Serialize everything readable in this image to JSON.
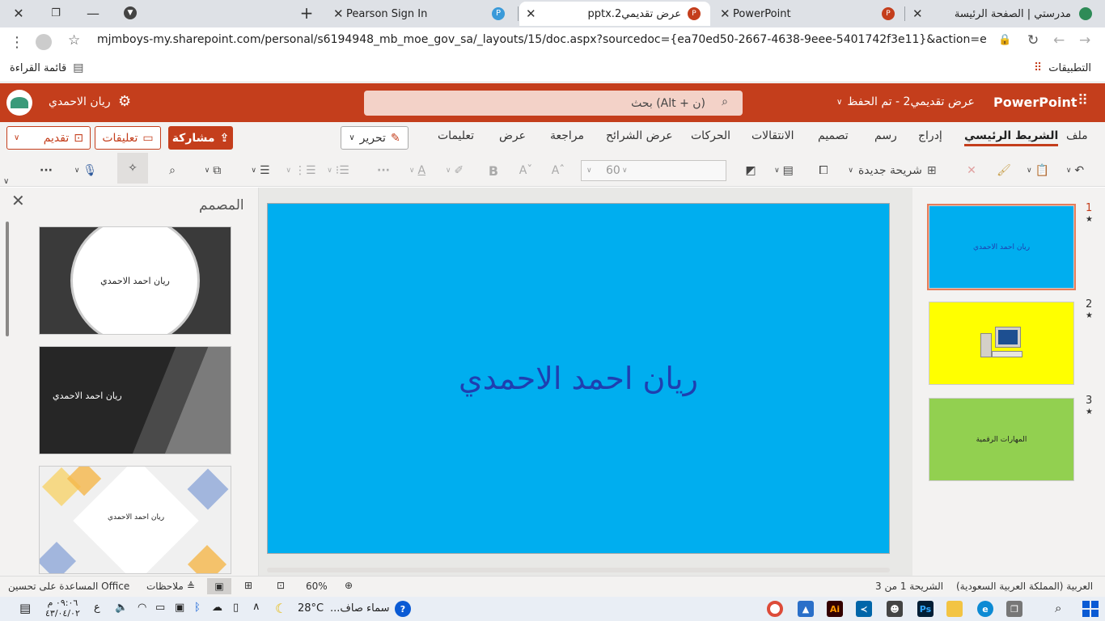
{
  "browser": {
    "tabs": [
      {
        "title": "مدرستي | الصفحة الرئيسة",
        "active": false
      },
      {
        "title": "PowerPoint",
        "active": false
      },
      {
        "title": "عرض تقديمي2.pptx",
        "active": true
      },
      {
        "title": "Pearson Sign In",
        "active": false
      }
    ],
    "new_tab": "+",
    "url": "mjmboys-my.sharepoint.com/personal/s6194948_mb_moe_gov_sa/_layouts/15/doc.aspx?sourcedoc={ea70ed50-2667-4638-9eee-5401742f3e11}&action=edit",
    "bookmarks": {
      "apps": "التطبيقات",
      "reading_list": "قائمة القراءة"
    }
  },
  "header": {
    "app_name": "PowerPoint",
    "doc_title": "عرض تقديمي2 - تم الحفظ",
    "search_placeholder": "بحث (Alt + ن)",
    "user_name": "ريان الاحمدي"
  },
  "ribbon": {
    "tabs": [
      "ملف",
      "الشريط الرئيسي",
      "إدراج",
      "رسم",
      "تصميم",
      "الانتقالات",
      "الحركات",
      "عرض الشرائح",
      "مراجعة",
      "عرض",
      "تعليمات"
    ],
    "active_tab": "الشريط الرئيسي",
    "edit_label": "تحرير",
    "share_label": "مشاركة",
    "comments_label": "تعليقات",
    "present_label": "تقديم",
    "new_slide_label": "شريحة جديدة",
    "font_size": "60",
    "bold_label": "B",
    "more_label": "···"
  },
  "designer": {
    "title": "المصمم",
    "options": [
      {
        "text": "ريان احمد الاحمدي",
        "style": "circle-dark"
      },
      {
        "text": "ريان احمد الاحمدي",
        "style": "diagonal-dark"
      },
      {
        "text": "ريان احمد الاحمدي",
        "style": "diamond-light"
      }
    ]
  },
  "slide": {
    "title": "ريان احمد الاحمدي",
    "background": "#00aeef",
    "text_color": "#1f3fb0"
  },
  "thumbnails": [
    {
      "num": "1",
      "text": "ريان احمد الاحمدي",
      "bg": "#00aeef"
    },
    {
      "num": "2",
      "text": "",
      "bg": "#ffff00"
    },
    {
      "num": "3",
      "text": "المهارات الرقمية",
      "bg": "#92d050"
    }
  ],
  "status": {
    "slide_info": "الشريحة 1 من 3",
    "language": "العربية (المملكة العربية السعودية)",
    "zoom": "60%",
    "notes": "ملاحظات",
    "help": "المساعدة على تحسين Office"
  },
  "taskbar": {
    "weather": "سماء صاف...",
    "temperature": "28°C",
    "lang": "ع",
    "time": "٠٩:٠٦ م",
    "date": "٤٣/٠٤/٠٢"
  },
  "colors": {
    "brand": "#c43e1c",
    "accent": "#00aeef"
  }
}
